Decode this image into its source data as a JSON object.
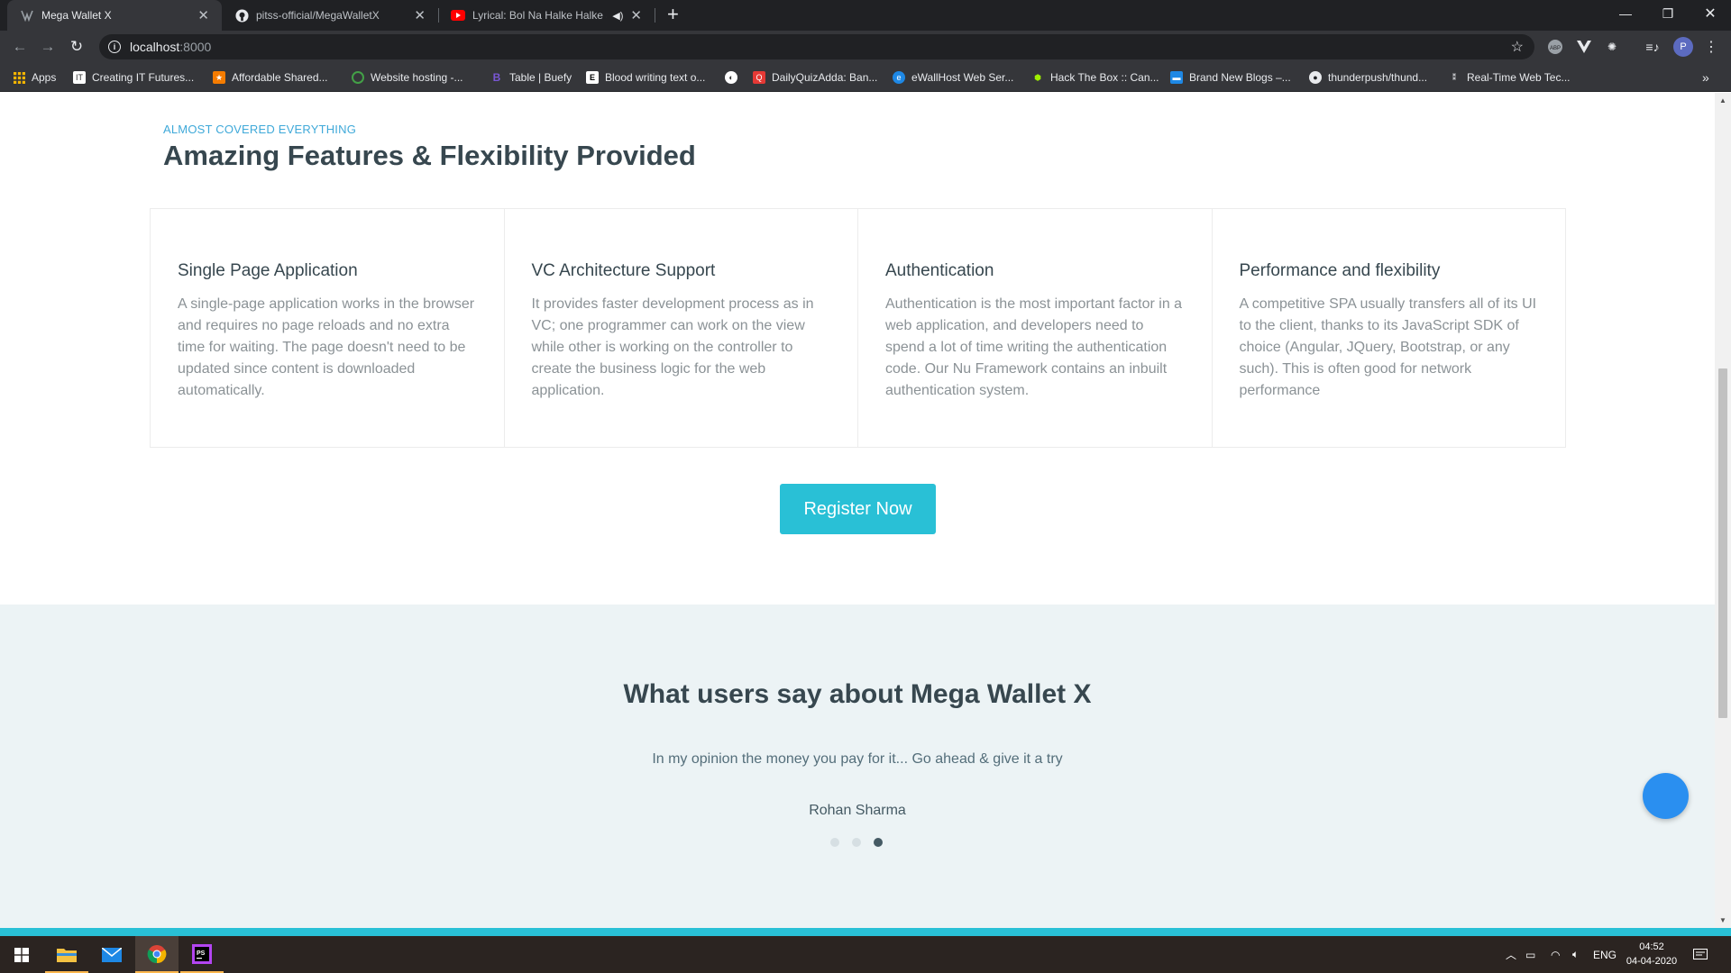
{
  "browser": {
    "tabs": [
      {
        "title": "Mega Wallet X",
        "favicon": "wallet-icon",
        "active": true
      },
      {
        "title": "pitss-official/MegaWalletX",
        "favicon": "github-icon",
        "active": false
      },
      {
        "title": "Lyrical: Bol Na Halke Halke S",
        "favicon": "youtube-icon",
        "active": false
      }
    ],
    "url_host": "localhost",
    "url_port": ":8000",
    "profile_initial": "P",
    "bookmarks": [
      {
        "label": "Apps",
        "icon": "apps-grid-icon",
        "color": "#f4b400"
      },
      {
        "label": "Creating IT Futures...",
        "icon": "bookmark-site-icon",
        "color": "#ffffff"
      },
      {
        "label": "Affordable Shared...",
        "icon": "bookmark-site-icon",
        "color": "#f57c00"
      },
      {
        "label": "Website hosting -...",
        "icon": "bookmark-site-icon",
        "color": "#43a047"
      },
      {
        "label": "Table | Buefy",
        "icon": "buefy-icon",
        "color": "#7957d5"
      },
      {
        "label": "Blood writing text o...",
        "icon": "bookmark-site-icon",
        "color": "#ffffff"
      },
      {
        "label": "",
        "icon": "globe-icon",
        "color": "#ffffff"
      },
      {
        "label": "DailyQuizAdda: Ban...",
        "icon": "bookmark-site-icon",
        "color": "#e53935"
      },
      {
        "label": "eWallHost Web Ser...",
        "icon": "bookmark-site-icon",
        "color": "#1e88e5"
      },
      {
        "label": "Hack The Box :: Can...",
        "icon": "hackthebox-icon",
        "color": "#9fef00"
      },
      {
        "label": "Brand New Blogs –...",
        "icon": "bookmark-site-icon",
        "color": "#1e88e5"
      },
      {
        "label": "thunderpush/thund...",
        "icon": "github-icon",
        "color": "#ffffff"
      },
      {
        "label": "Real-Time Web Tec...",
        "icon": "bookmark-site-icon",
        "color": "#ffffff"
      }
    ]
  },
  "features_section": {
    "eyebrow": "ALMOST COVERED EVERYTHING",
    "title": "Amazing Features & Flexibility Provided",
    "cards": [
      {
        "title": "Single Page Application",
        "text": "A single-page application works in the browser and requires no page reloads and no extra time for waiting. The page doesn't need to be updated since content is downloaded automatically."
      },
      {
        "title": "VC Architecture Support",
        "text": "It provides faster development process as in VC; one programmer can work on the view while other is working on the controller to create the business logic for the web application."
      },
      {
        "title": "Authentication",
        "text": "Authentication is the most important factor in a web application, and developers need to spend a lot of time writing the authentication code. Our Nu Framework contains an inbuilt authentication system."
      },
      {
        "title": "Performance and flexibility",
        "text": "A competitive SPA usually transfers all of its UI to the client, thanks to its JavaScript SDK of choice (Angular, JQuery, Bootstrap, or any such). This is often good for network performance"
      }
    ],
    "register_label": "Register Now"
  },
  "testimonials": {
    "title": "What users say about Mega Wallet X",
    "quote": "In my opinion the money you pay for it... Go ahead & give it a try",
    "author": "Rohan Sharma",
    "slides": 3,
    "active_slide": 3
  },
  "taskbar": {
    "language": "ENG",
    "time": "04:52",
    "date": "04-04-2020"
  },
  "colors": {
    "accent": "#29c0d6",
    "eyebrow": "#3fa9d9",
    "heading": "#37474f",
    "testimonial_bg": "#ecf3f5",
    "fab": "#2a8ff0"
  }
}
